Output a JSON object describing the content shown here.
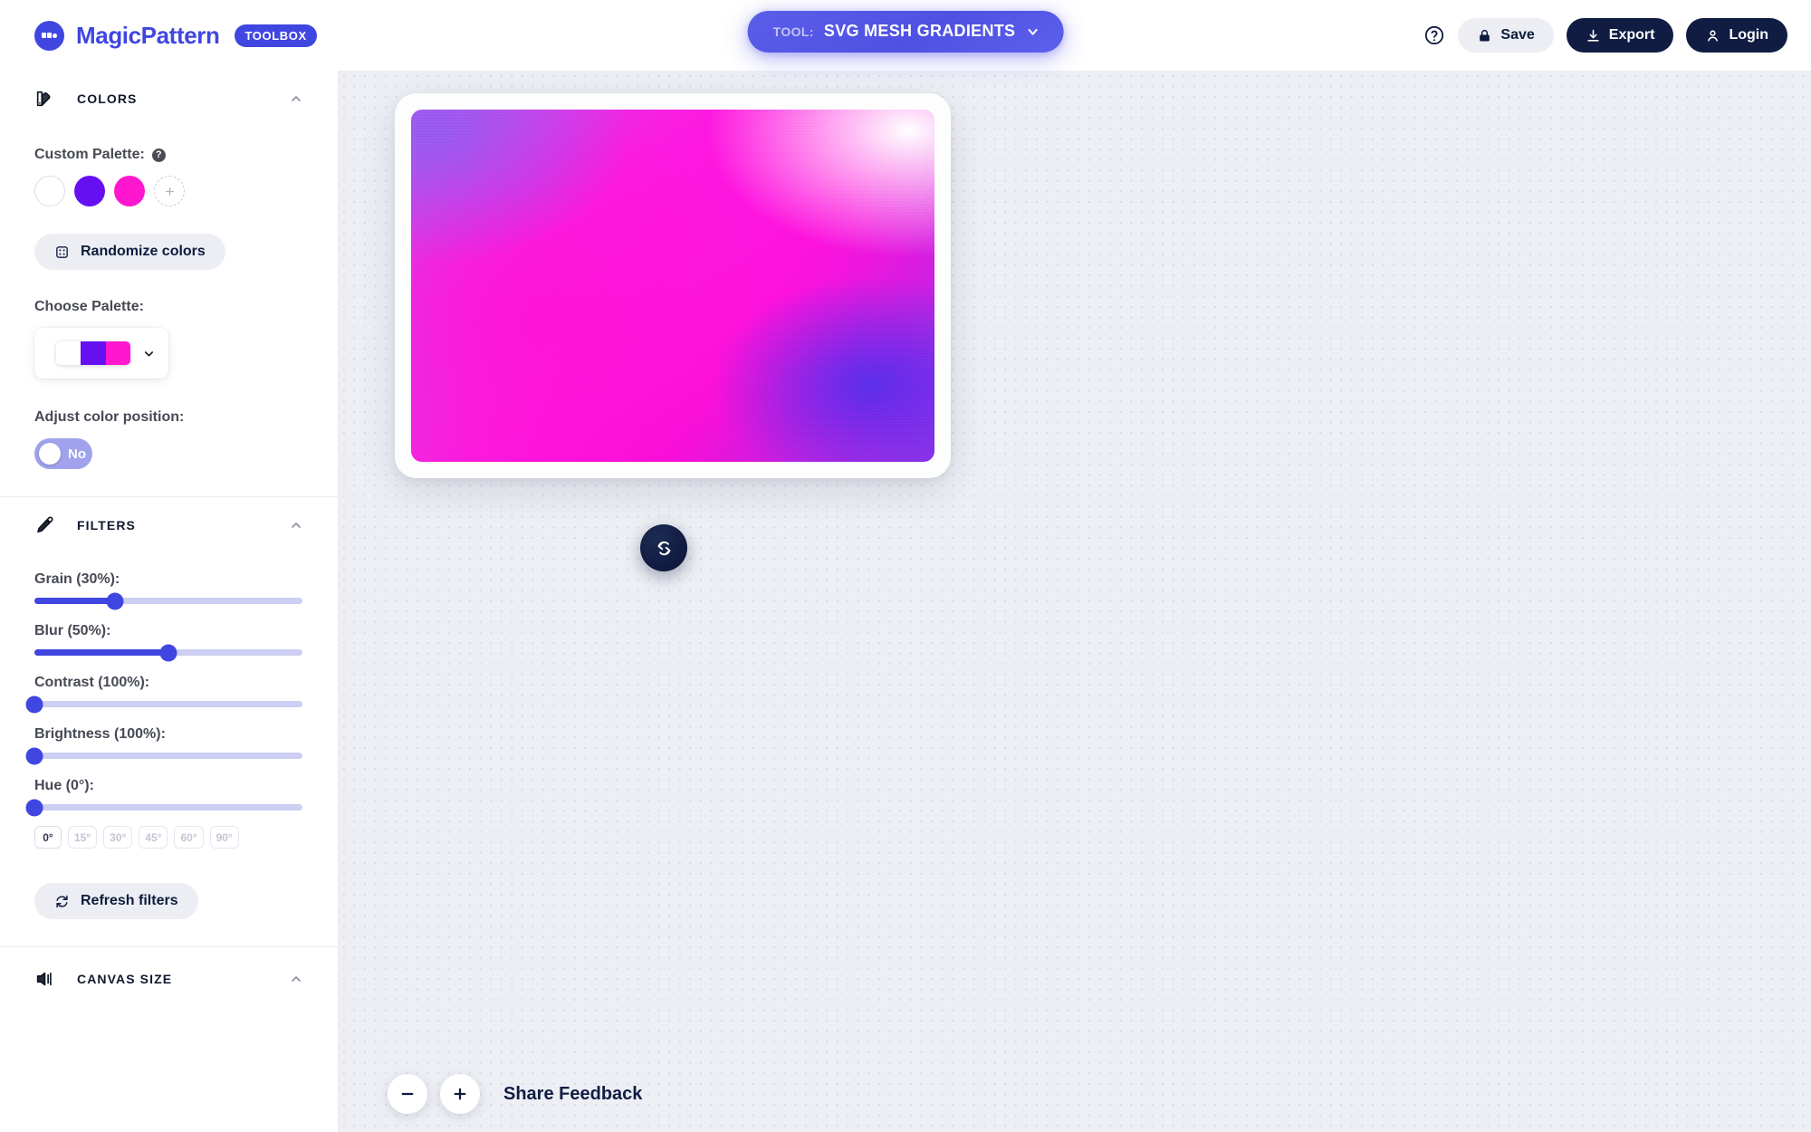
{
  "brand": {
    "name": "MagicPattern",
    "tag": "TOOLBOX",
    "logo_icon": "magicpattern-dots-logo-icon",
    "accent": "#4046e0"
  },
  "tool_selector": {
    "prefix": "TOOL:",
    "value": "SVG MESH GRADIENTS",
    "caret_icon": "chevron-down-icon"
  },
  "topbar": {
    "help_icon": "question-circle-icon",
    "save": {
      "label": "Save",
      "icon": "lock-icon"
    },
    "export": {
      "label": "Export",
      "icon": "download-icon"
    },
    "login": {
      "label": "Login",
      "icon": "user-icon"
    }
  },
  "sidebar": {
    "sections": [
      {
        "title": "COLORS",
        "icon": "palette-icon",
        "caret": "chevron-up-icon"
      },
      {
        "title": "FILTERS",
        "icon": "eyedropper-icon",
        "caret": "chevron-up-icon"
      },
      {
        "title": "CANVAS SIZE",
        "icon": "canvas-size-icon",
        "caret": "chevron-up-icon"
      }
    ],
    "colors": {
      "custom_palette_label": "Custom Palette:",
      "help_badge": "?",
      "swatches": [
        "#ffffff",
        "#6610f2",
        "#ff17cf"
      ],
      "add_swatch_icon": "plus-icon",
      "randomize": {
        "label": "Randomize colors",
        "icon": "dice-icon"
      },
      "choose_palette_label": "Choose Palette:",
      "palette_preview": [
        "#ffffff",
        "#6610f2",
        "#ff17cf"
      ],
      "palette_caret_icon": "chevron-down-icon",
      "adjust_position_label": "Adjust color position:",
      "adjust_position_value": "No"
    },
    "filters": {
      "sliders": [
        {
          "label": "Grain (30%):",
          "name": "grain",
          "value": 30,
          "pct": 30
        },
        {
          "label": "Blur (50%):",
          "name": "blur",
          "value": 50,
          "pct": 50
        },
        {
          "label": "Contrast (100%):",
          "name": "contrast",
          "value": 100,
          "pct": 0
        },
        {
          "label": "Brightness (100%):",
          "name": "brightness",
          "value": 100,
          "pct": 0
        },
        {
          "label": "Hue (0°):",
          "name": "hue",
          "value": 0,
          "pct": 0
        }
      ],
      "hue_presets": [
        "0°",
        "15°",
        "30°",
        "45°",
        "60°",
        "90°"
      ],
      "hue_active": "0°",
      "refresh": {
        "label": "Refresh filters",
        "icon": "refresh-icon"
      }
    }
  },
  "canvas": {
    "refresh_fab_icon": "refresh-gradient-icon",
    "zoom_out_icon": "minus-icon",
    "zoom_in_icon": "plus-icon",
    "feedback_label": "Share Feedback",
    "gradient_colors": [
      "#ffffff",
      "#6610f2",
      "#ff17cf"
    ]
  }
}
